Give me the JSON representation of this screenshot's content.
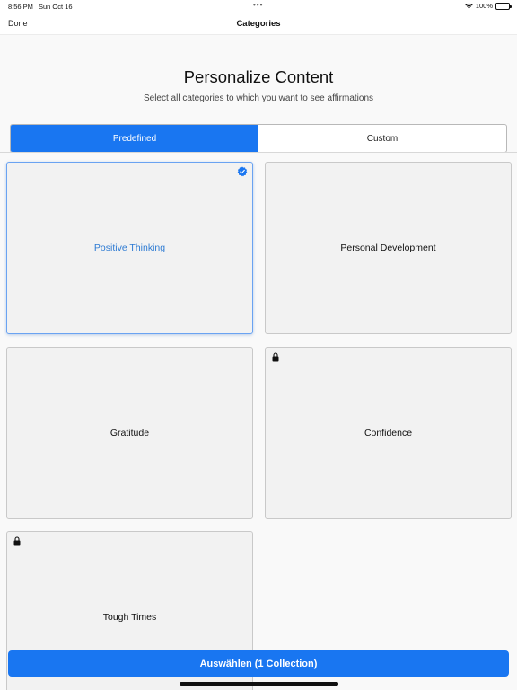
{
  "status_bar": {
    "time": "8:56 PM",
    "date": "Sun Oct 16",
    "battery": "100%"
  },
  "nav": {
    "done_label": "Done",
    "title": "Categories"
  },
  "header": {
    "title": "Personalize Content",
    "subtitle": "Select all categories to which you want to see affirmations"
  },
  "tabs": [
    {
      "label": "Predefined",
      "active": true
    },
    {
      "label": "Custom",
      "active": false
    }
  ],
  "categories": [
    {
      "label": "Positive Thinking",
      "selected": true,
      "locked": false,
      "icon": "checkmark-badge-icon"
    },
    {
      "label": "Personal Development",
      "selected": false,
      "locked": false
    },
    {
      "label": "Gratitude",
      "selected": false,
      "locked": false
    },
    {
      "label": "Confidence",
      "selected": false,
      "locked": true,
      "icon": "lock-icon"
    },
    {
      "label": "Tough Times",
      "selected": false,
      "locked": true,
      "icon": "lock-icon"
    }
  ],
  "select_button": {
    "label": "Auswählen (1 Collection)"
  },
  "colors": {
    "accent": "#1976f1",
    "selected_text": "#2e7bd3",
    "card_bg": "#f2f2f2"
  }
}
